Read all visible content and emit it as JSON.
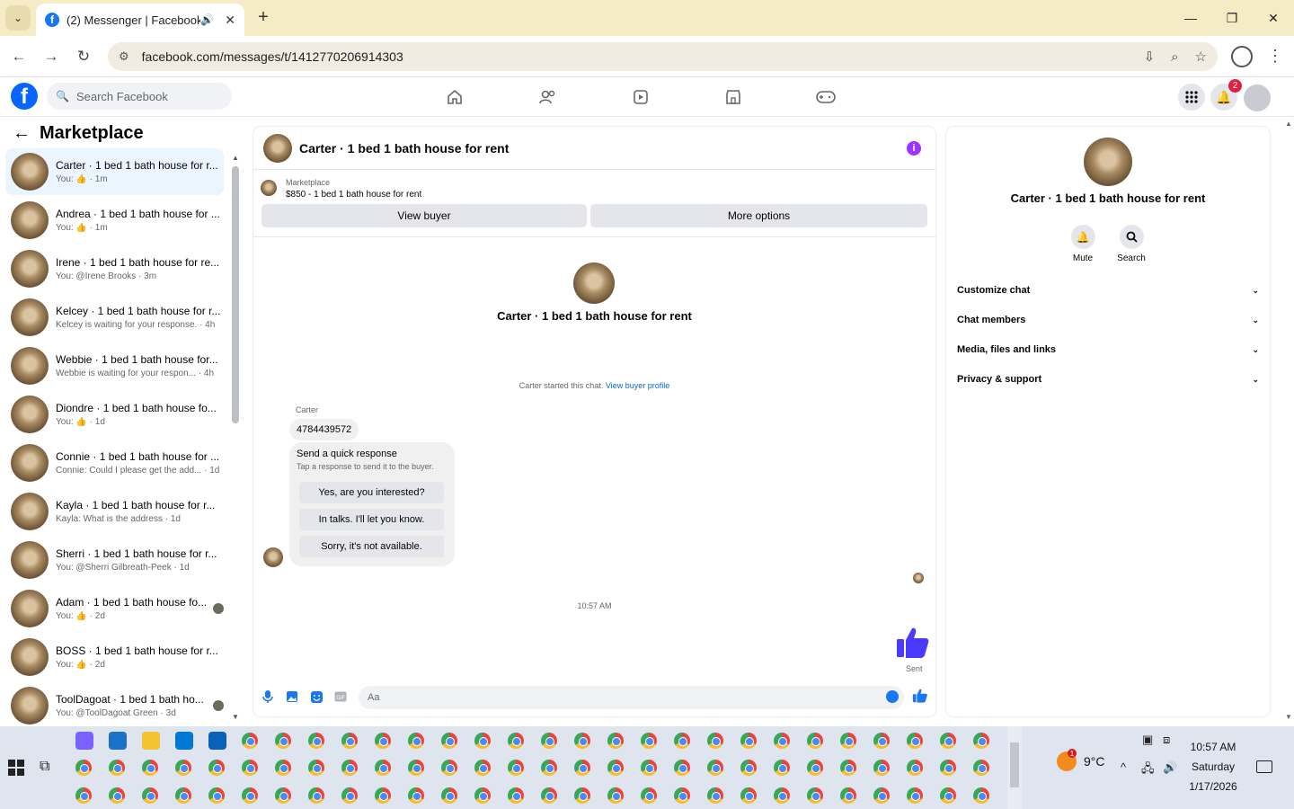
{
  "browser": {
    "tab_title": "(2) Messenger | Facebook",
    "url": "facebook.com/messages/t/1412770206914303"
  },
  "fb": {
    "search_placeholder": "Search Facebook",
    "notif_count": "2"
  },
  "left": {
    "title": "Marketplace",
    "chats": [
      {
        "name": "Carter · 1 bed 1 bath house for r...",
        "sub": "You: 👍 · 1m",
        "active": true
      },
      {
        "name": "Andrea · 1 bed 1 bath house for ...",
        "sub": "You: 👍 · 1m"
      },
      {
        "name": "Irene · 1 bed 1 bath house for re...",
        "sub": "You: @Irene Brooks · 3m"
      },
      {
        "name": "Kelcey · 1 bed 1 bath house for r...",
        "sub": "Kelcey is waiting for your response. · 4h"
      },
      {
        "name": "Webbie · 1 bed 1 bath house for...",
        "sub": "Webbie is waiting for your respon... · 4h"
      },
      {
        "name": "Diondre · 1 bed 1 bath house fo...",
        "sub": "You: 👍 · 1d"
      },
      {
        "name": "Connie · 1 bed 1 bath house for ...",
        "sub": "Connie: Could I please get the add... · 1d"
      },
      {
        "name": "Kayla · 1 bed 1 bath house for r...",
        "sub": "Kayla: What is the address · 1d"
      },
      {
        "name": "Sherri · 1 bed 1 bath house for r...",
        "sub": "You: @Sherri Gilbreath-Peek · 1d"
      },
      {
        "name": "Adam · 1 bed 1 bath house fo...",
        "sub": "You: 👍 · 2d"
      },
      {
        "name": "BOSS · 1 bed 1 bath house for r...",
        "sub": "You: 👍 · 2d"
      },
      {
        "name": "ToolDagoat · 1 bed 1 bath ho...",
        "sub": "You: @ToolDagoat Green · 3d"
      }
    ]
  },
  "chat": {
    "header_name": "Carter · 1 bed 1 bath house for rent",
    "marketplace_label": "Marketplace",
    "listing": "$850 - 1 bed 1 bath house for rent",
    "view_buyer": "View buyer",
    "more_options": "More options",
    "hero_name": "Carter · 1 bed 1 bath house for rent",
    "started_text": "Carter started this chat.",
    "view_buyer_profile": "View buyer profile",
    "sender": "Carter",
    "phone": "4784439572",
    "quick_title": "Send a quick response",
    "quick_sub": "Tap a response to send it to the buyer.",
    "quick_1": "Yes, are you interested?",
    "quick_2": "In talks. I'll let you know.",
    "quick_3": "Sorry, it's not available.",
    "time": "10:57 AM",
    "sent": "Sent",
    "composer_placeholder": "Aa"
  },
  "right": {
    "name": "Carter · 1 bed 1 bath house for rent",
    "mute": "Mute",
    "search": "Search",
    "rows": [
      "Customize chat",
      "Chat members",
      "Media, files and links",
      "Privacy & support"
    ]
  },
  "taskbar": {
    "temp": "9°C",
    "weather_badge": "1",
    "time": "10:57 AM",
    "day": "Saturday",
    "date": "1/17/2026"
  },
  "colors": {
    "fb_blue": "#0866ff",
    "messenger_purple": "#4a3aff",
    "tab_strip": "#f5ecc5"
  }
}
